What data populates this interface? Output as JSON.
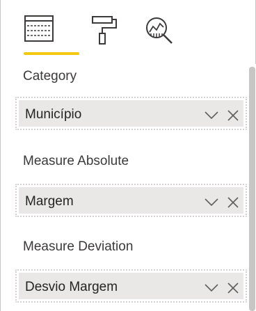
{
  "tabs": [
    {
      "icon": "fields-table-icon"
    },
    {
      "icon": "format-paint-roller-icon"
    },
    {
      "icon": "analytics-magnifier-icon"
    }
  ],
  "accent_color": "#f2c811",
  "wells": [
    {
      "label": "Category",
      "value": "Município"
    },
    {
      "label": "Measure Absolute",
      "value": "Margem"
    },
    {
      "label": "Measure Deviation",
      "value": "Desvio Margem"
    }
  ]
}
